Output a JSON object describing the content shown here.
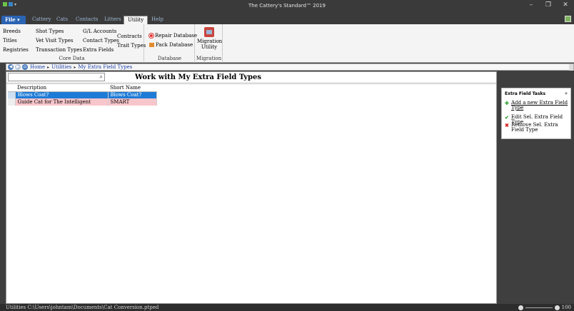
{
  "window": {
    "title": "The Cattery's Standard™ 2019",
    "minimize": "–",
    "restore": "❐",
    "close": "✕"
  },
  "menu": {
    "file": "File ▾",
    "tabs": [
      "Cattery",
      "Cats",
      "Contacts",
      "Litters",
      "Utility",
      "Help"
    ],
    "active": "Utility"
  },
  "ribbon": {
    "core_data": {
      "caption": "Core Data",
      "col1": [
        "Breeds",
        "Titles",
        "Registries"
      ],
      "col2": [
        "Shot Types",
        "Vet Visit Types",
        "Transaction Types"
      ],
      "col3": [
        "G/L Accounts",
        "Contact Types",
        "Extra Fields"
      ],
      "col4": [
        "Contracts",
        "Trait Types"
      ]
    },
    "database": {
      "caption": "Database",
      "repair": "Repair Database",
      "pack": "Pack Database"
    },
    "migration": {
      "caption": "Migration",
      "utility": "Migration Utility"
    }
  },
  "breadcrumb": {
    "items": [
      "Home",
      "Utilities",
      "My Extra Field Types"
    ]
  },
  "main": {
    "search_placeholder": "",
    "heading": "Work with My Extra Field Types",
    "columns": [
      "Description",
      "Short Name"
    ],
    "rows": [
      {
        "description": "Blows Coat?",
        "short": "Blows Coat?"
      },
      {
        "description": "Guide Cat for The Intelligent",
        "short": "SMART"
      }
    ]
  },
  "tasks": {
    "header": "Extra Field Tasks",
    "collapse": "»",
    "items": [
      {
        "label": "Add a new Extra Field Type",
        "icon": "plus-icon"
      },
      {
        "label": "Edit Sel. Extra Field Type",
        "icon": "check-icon"
      },
      {
        "label": "Remove Sel. Extra Field Type",
        "icon": "delete-x-icon"
      }
    ]
  },
  "status": {
    "text": "Utilities   C:\\Users\\johntam\\Documents\\Cat Conversion.ptped",
    "zoom": "100"
  },
  "colors": {
    "selected_row": "#1e7bd6",
    "pink_row": "#f7c6cb",
    "file_tab": "#2b63b3"
  }
}
